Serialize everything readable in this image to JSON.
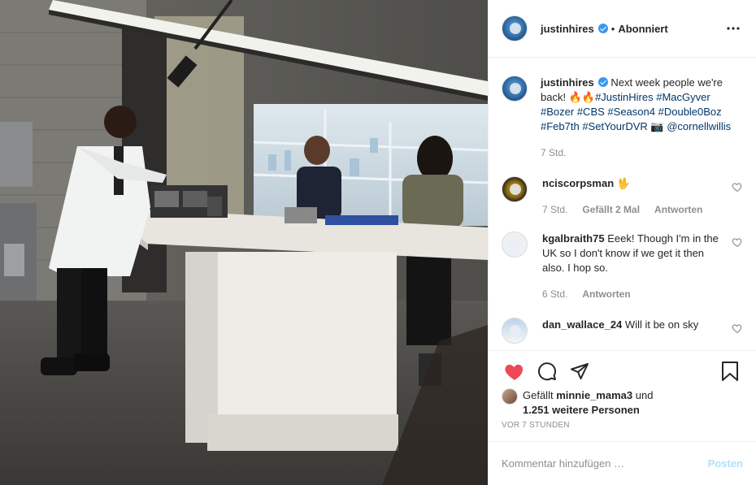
{
  "header": {
    "username": "justinhires",
    "separator": "•",
    "follow_status": "Abonniert"
  },
  "caption": {
    "username": "justinhires",
    "text_lead": "Next week people we're back! 🔥🔥",
    "hashtags": [
      "#JustinHires",
      "#MacGyver",
      "#Bozer",
      "#CBS",
      "#Season4",
      "#Double0Boz",
      "#Feb7th",
      "#SetYourDVR"
    ],
    "camera": "📷",
    "mention": "@cornellwillis",
    "time": "7 Std."
  },
  "comments": [
    {
      "username": "nciscorpsman",
      "text": "🖖",
      "time": "7 Std.",
      "likes": "Gefällt 2 Mal",
      "reply": "Antworten"
    },
    {
      "username": "kgalbraith75",
      "text": "Eeek! Though I'm in the UK so I don't know if we get it then also. I hop so.",
      "time": "6 Std.",
      "reply": "Antworten"
    },
    {
      "username": "dan_wallace_24",
      "text": "Will it be on sky"
    }
  ],
  "likes": {
    "prefix": "Gefällt ",
    "liker": "minnie_mama3",
    "and": " und",
    "others": "1.251 weitere Personen"
  },
  "post_time": "VOR 7 STUNDEN",
  "add_comment": {
    "placeholder": "Kommentar hinzufügen …",
    "post_label": "Posten"
  },
  "colors": {
    "heart": "#ed4956",
    "link": "#00376b",
    "verified": "#3897f0",
    "post_disabled": "#b2dffc",
    "muted": "#8e8e8e"
  }
}
